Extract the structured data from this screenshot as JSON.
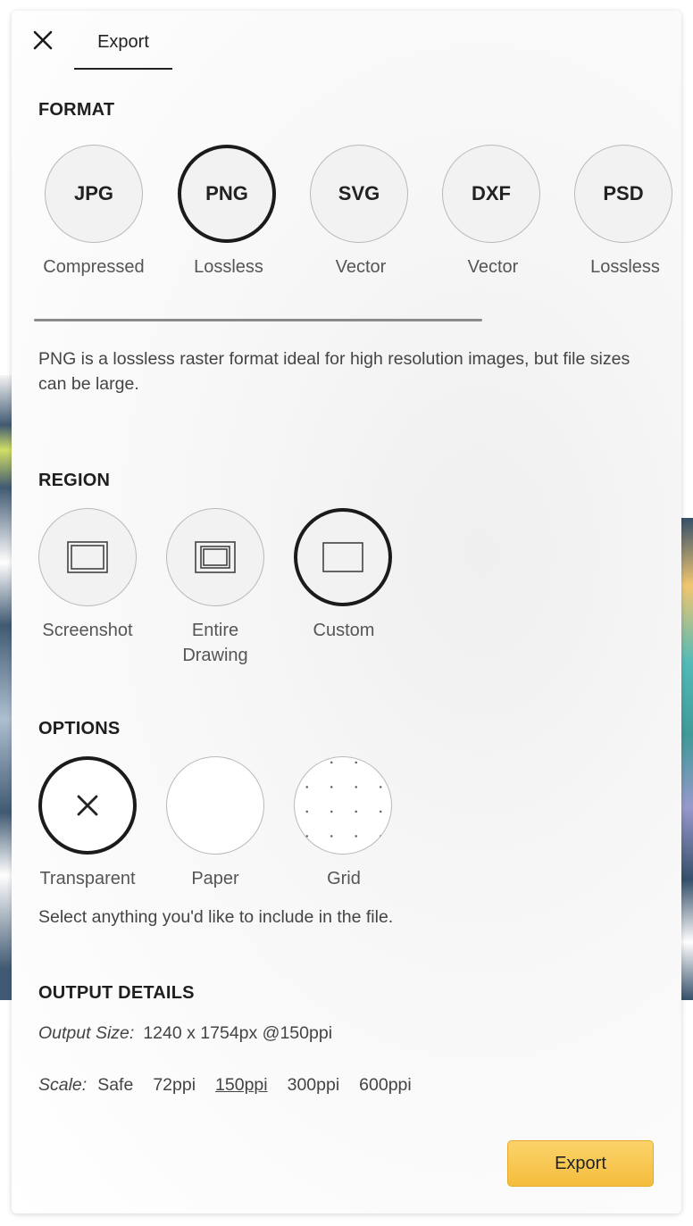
{
  "header": {
    "tab_label": "Export"
  },
  "format": {
    "title": "FORMAT",
    "options": [
      {
        "label": "JPG",
        "caption": "Compressed",
        "selected": false
      },
      {
        "label": "PNG",
        "caption": "Lossless",
        "selected": true
      },
      {
        "label": "SVG",
        "caption": "Vector",
        "selected": false
      },
      {
        "label": "DXF",
        "caption": "Vector",
        "selected": false
      },
      {
        "label": "PSD",
        "caption": "Lossless",
        "selected": false
      }
    ],
    "description": "PNG is a lossless raster format ideal for high resolution images, but file sizes can be large."
  },
  "region": {
    "title": "REGION",
    "options": [
      {
        "caption": "Screenshot",
        "icon": "screenshot-region-icon",
        "selected": false
      },
      {
        "caption": "Entire\nDrawing",
        "icon": "entire-drawing-region-icon",
        "selected": false
      },
      {
        "caption": "Custom",
        "icon": "custom-region-icon",
        "selected": true
      }
    ]
  },
  "options": {
    "title": "OPTIONS",
    "items": [
      {
        "caption": "Transparent",
        "icon": "transparent-x-icon",
        "selected": true
      },
      {
        "caption": "Paper",
        "icon": "paper-icon",
        "selected": false
      },
      {
        "caption": "Grid",
        "icon": "grid-dots-icon",
        "selected": false
      }
    ],
    "hint": "Select anything you'd like to include in the file."
  },
  "output": {
    "title": "OUTPUT DETAILS",
    "size_label": "Output Size:",
    "size_value": "1240 x 1754px @150ppi",
    "scale_label": "Scale:",
    "scale_options": [
      "Safe",
      "72ppi",
      "150ppi",
      "300ppi",
      "600ppi"
    ],
    "scale_selected": "150ppi"
  },
  "footer": {
    "export_label": "Export",
    "export_color": "#f7c44f"
  }
}
